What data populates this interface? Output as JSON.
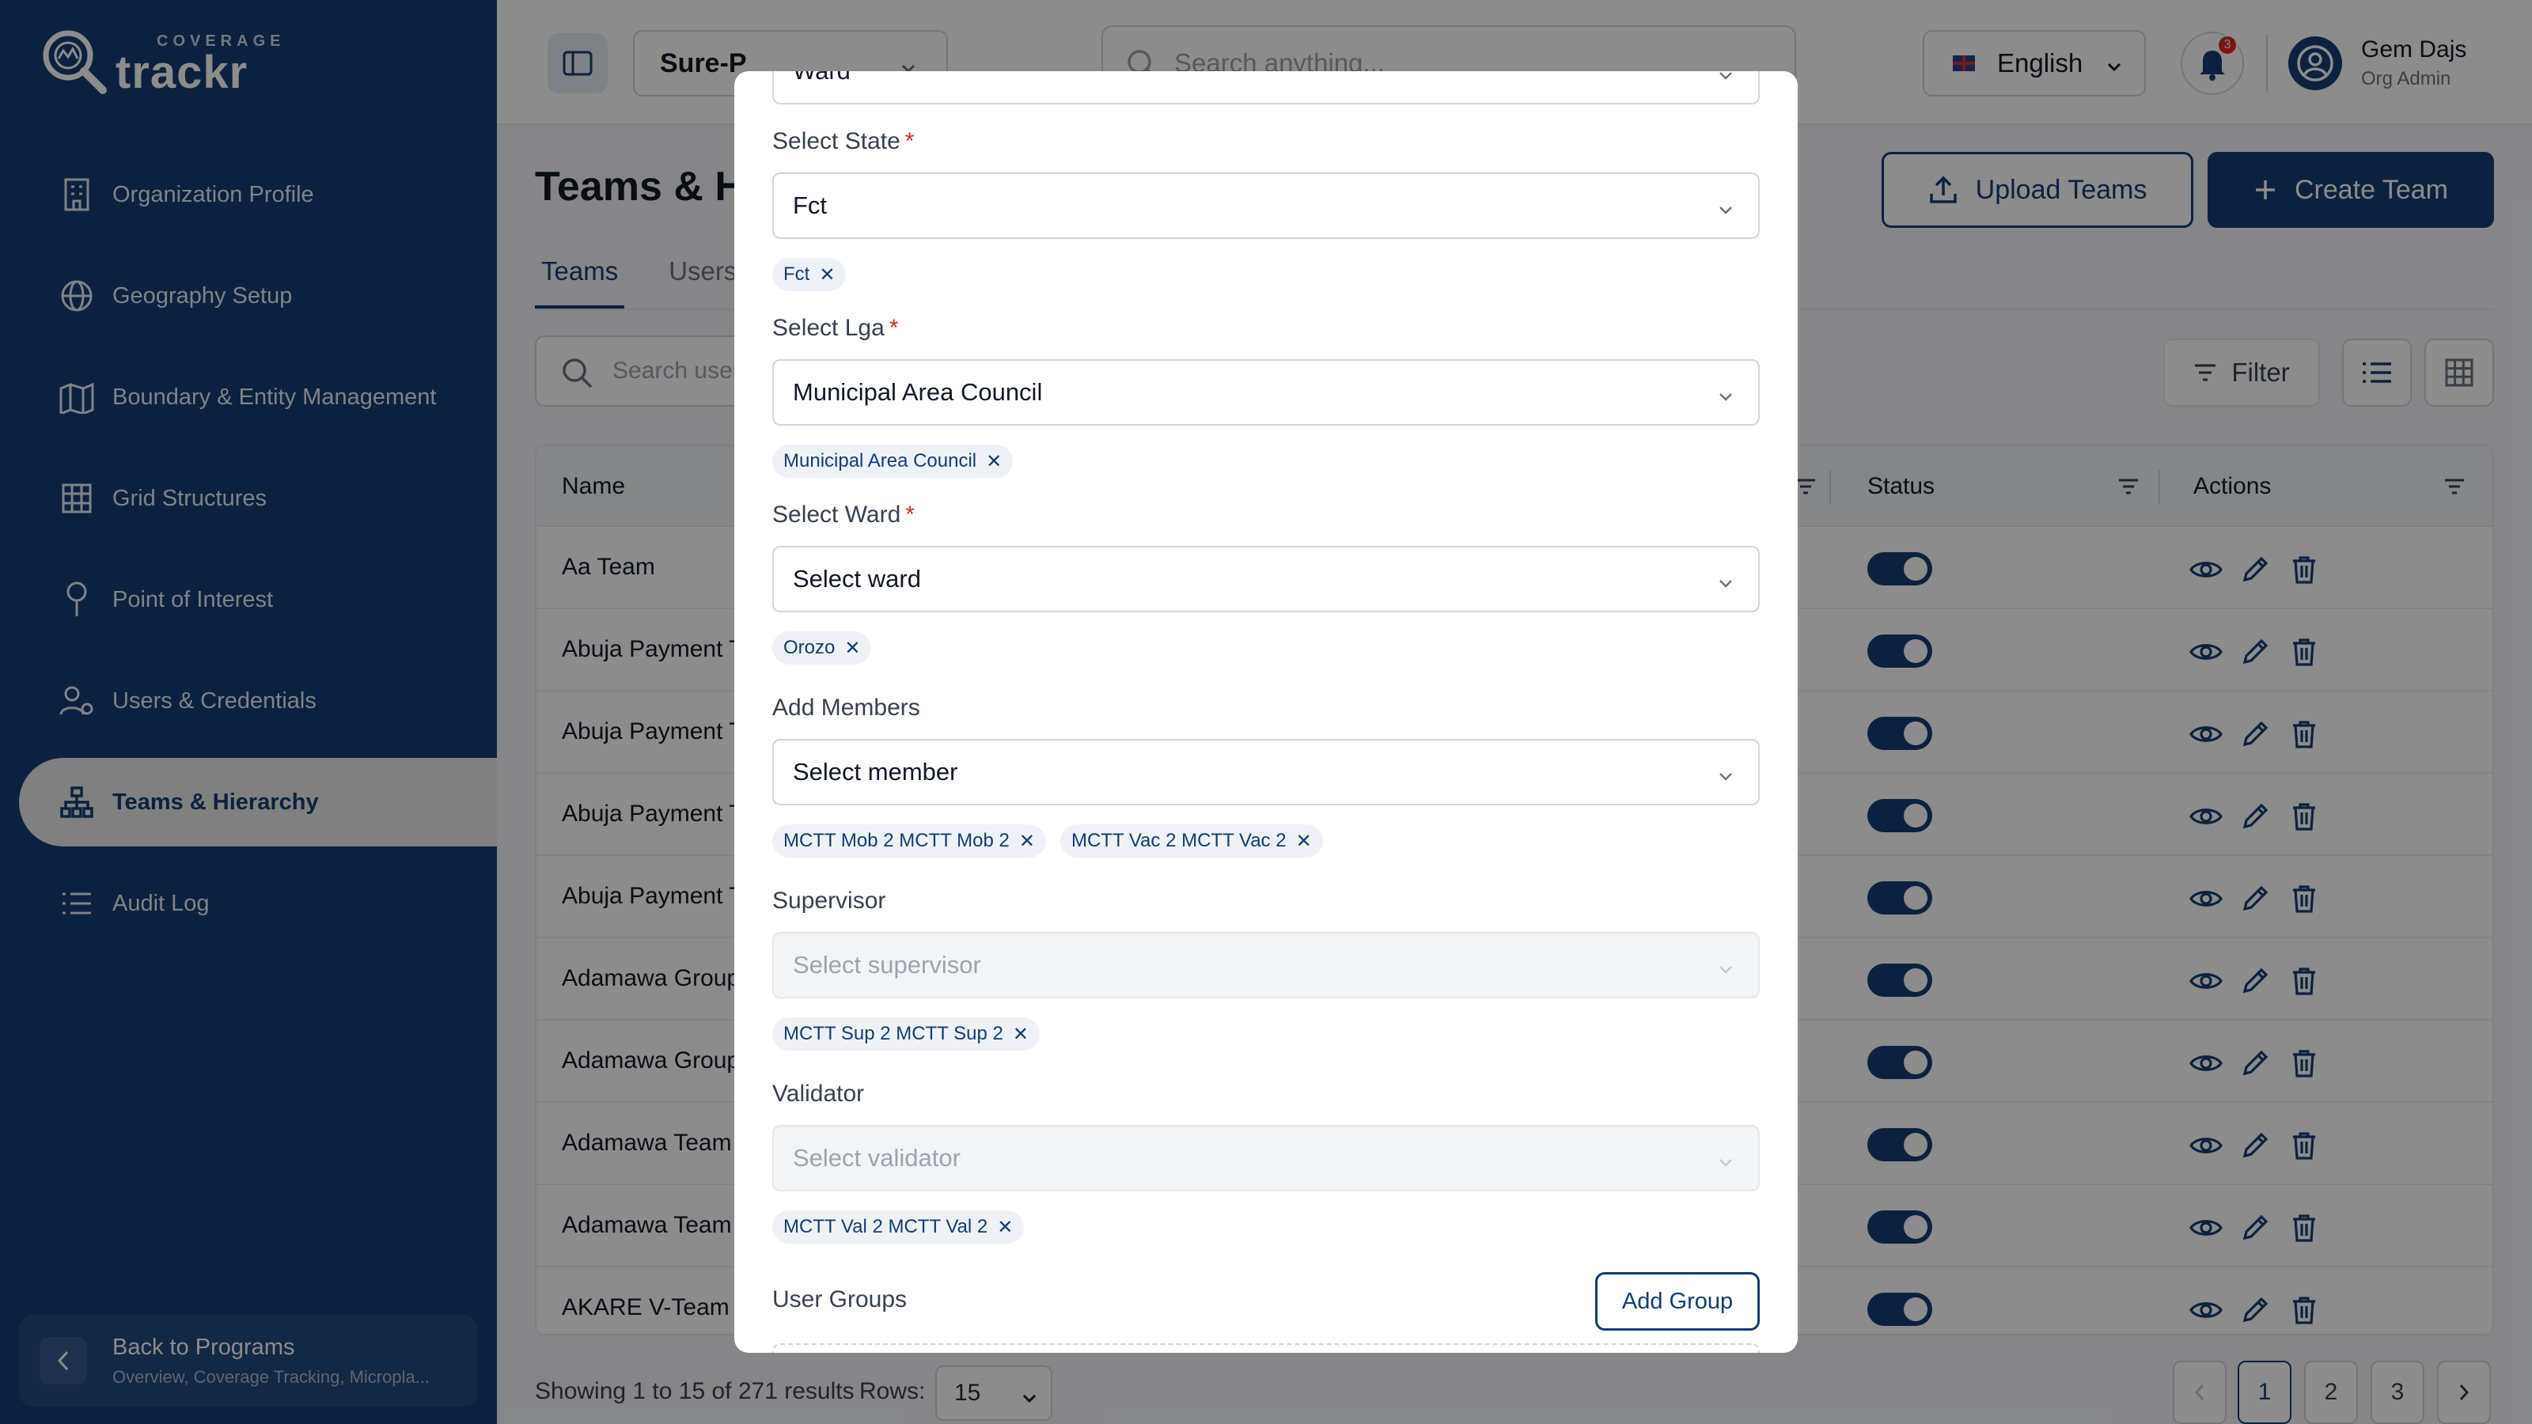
{
  "brand": {
    "small": "COVERAGE",
    "name": "trackr"
  },
  "sidebar": {
    "items": [
      {
        "label": "Organization Profile",
        "icon": "building-icon"
      },
      {
        "label": "Geography Setup",
        "icon": "globe-icon"
      },
      {
        "label": "Boundary & Entity Management",
        "icon": "map-icon"
      },
      {
        "label": "Grid Structures",
        "icon": "grid-icon"
      },
      {
        "label": "Point of Interest",
        "icon": "pin-icon"
      },
      {
        "label": "Users & Credentials",
        "icon": "user-gear-icon"
      },
      {
        "label": "Teams & Hierarchy",
        "icon": "hierarchy-icon",
        "active": true
      },
      {
        "label": "Audit Log",
        "icon": "list-icon"
      }
    ],
    "back": {
      "title": "Back to Programs",
      "subtitle": "Overview, Coverage Tracking, Micropla..."
    }
  },
  "header": {
    "program": "Sure-P",
    "search_placeholder": "Search anything...",
    "language": "English",
    "notifications": "3",
    "user_name": "Gem Dajs",
    "user_role": "Org Admin"
  },
  "page": {
    "title": "Teams & Hierarchy",
    "upload_label": "Upload Teams",
    "create_label": "Create Team",
    "tabs": [
      "Teams",
      "Users"
    ],
    "search_placeholder": "Search users...",
    "filter_label": "Filter"
  },
  "table": {
    "columns": {
      "name": "Name",
      "status": "Status",
      "actions": "Actions"
    },
    "rows": [
      "Aa Team",
      "Abuja Payment Team",
      "Abuja Payment Team",
      "Abuja Payment Team",
      "Abuja Payment Team",
      "Adamawa Group",
      "Adamawa Group",
      "Adamawa Team",
      "Adamawa Team",
      "AKARE V-Team"
    ]
  },
  "pagination": {
    "summary": "Showing 1 to 15 of 271 results",
    "rows_label": "Rows:",
    "rows_value": "15",
    "pages": [
      "1",
      "2",
      "3"
    ]
  },
  "modal": {
    "top_select": "Ward",
    "state": {
      "label": "Select State",
      "value": "Fct",
      "chips": [
        "Fct"
      ]
    },
    "lga": {
      "label": "Select Lga",
      "value": "Municipal Area Council",
      "chips": [
        "Municipal Area Council"
      ]
    },
    "ward": {
      "label": "Select Ward",
      "value": "Select ward",
      "chips": [
        "Orozo"
      ]
    },
    "members": {
      "label": "Add Members",
      "value": "Select member",
      "chips": [
        "MCTT Mob 2 MCTT Mob 2",
        "MCTT Vac 2 MCTT Vac 2"
      ]
    },
    "supervisor": {
      "label": "Supervisor",
      "value": "Select supervisor",
      "chips": [
        "MCTT Sup 2 MCTT Sup 2"
      ]
    },
    "validator": {
      "label": "Validator",
      "value": "Select validator",
      "chips": [
        "MCTT Val 2 MCTT Val 2"
      ]
    },
    "user_groups": {
      "label": "User Groups",
      "add_label": "Add Group"
    }
  },
  "colors": {
    "primary": "#143d73",
    "required": "#dc2626",
    "chip_bg": "#eef2f7"
  }
}
